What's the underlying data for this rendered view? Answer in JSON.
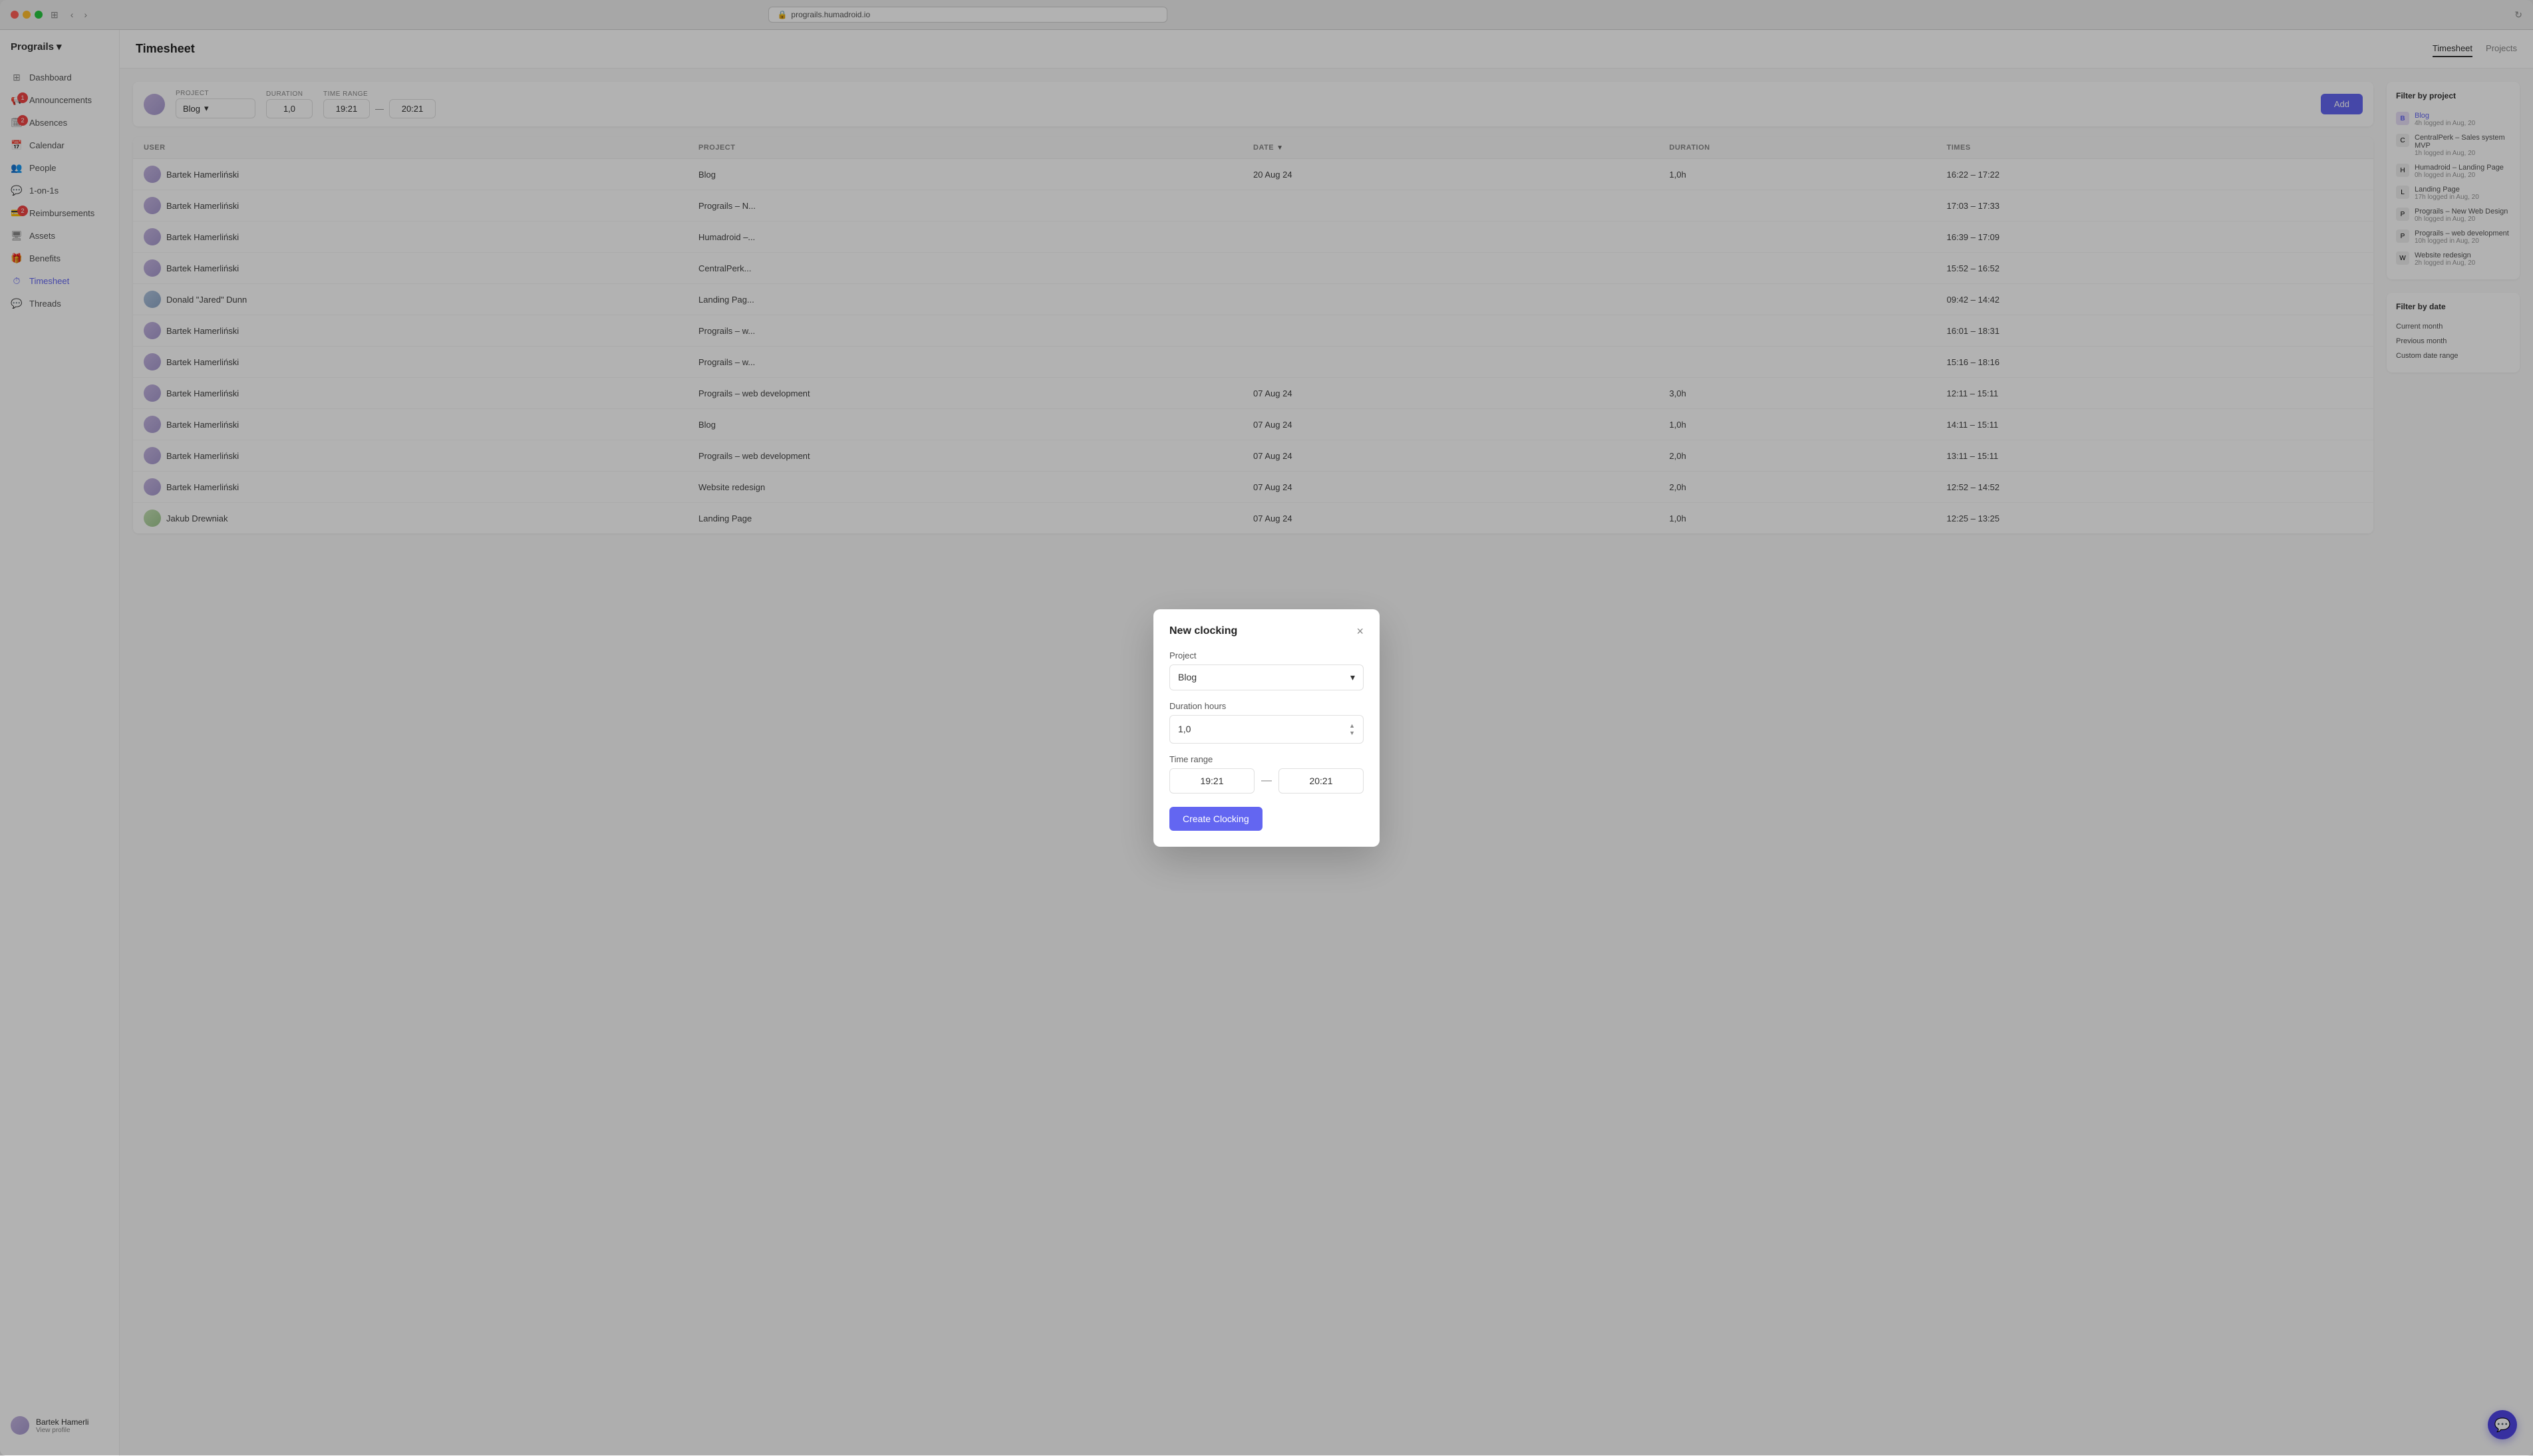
{
  "browser": {
    "url": "prograils.humadroid.io",
    "reload_icon": "↻"
  },
  "app": {
    "brand": "Prograils",
    "page_title": "Timesheet"
  },
  "header_tabs": [
    {
      "label": "Timesheet",
      "active": true
    },
    {
      "label": "Projects",
      "active": false
    }
  ],
  "sidebar": {
    "items": [
      {
        "label": "Dashboard",
        "icon": "⊞",
        "badge": null
      },
      {
        "label": "Announcements",
        "icon": "📢",
        "badge": "1"
      },
      {
        "label": "Absences",
        "icon": "🗓",
        "badge": "2"
      },
      {
        "label": "Calendar",
        "icon": "📅",
        "badge": null
      },
      {
        "label": "People",
        "icon": "👥",
        "badge": null
      },
      {
        "label": "1-on-1s",
        "icon": "💬",
        "badge": null
      },
      {
        "label": "Reimbursements",
        "icon": "💳",
        "badge": "2"
      },
      {
        "label": "Assets",
        "icon": "🖥",
        "badge": null
      },
      {
        "label": "Benefits",
        "icon": "🎁",
        "badge": null
      },
      {
        "label": "Timesheet",
        "icon": "⏱",
        "badge": null,
        "active": true
      },
      {
        "label": "Threads",
        "icon": "💬",
        "badge": null
      }
    ],
    "user": {
      "name": "Bartek Hamerli",
      "sub": "View profile"
    }
  },
  "add_row": {
    "project_label": "PROJECT",
    "project_value": "Blog",
    "duration_label": "DURATION",
    "duration_value": "1,0",
    "time_range_label": "TIME RANGE",
    "time_start": "19:21",
    "time_end": "20:21",
    "add_button": "Add"
  },
  "table": {
    "columns": [
      "USER",
      "PROJECT",
      "DATE",
      "DURATION",
      "TIMES"
    ],
    "rows": [
      {
        "user": "Bartek Hamerliński",
        "project": "Blog",
        "date": "20 Aug 24",
        "duration": "1,0h",
        "times": "16:22 – 17:22"
      },
      {
        "user": "Bartek Hamerliński",
        "project": "Prograils – N...",
        "date": "",
        "duration": "",
        "times": "17:03 – 17:33"
      },
      {
        "user": "Bartek Hamerliński",
        "project": "Humadroid –...",
        "date": "",
        "duration": "",
        "times": "16:39 – 17:09"
      },
      {
        "user": "Bartek Hamerliński",
        "project": "CentralPerk...",
        "date": "",
        "duration": "",
        "times": "15:52 – 16:52"
      },
      {
        "user": "Donald \"Jared\" Dunn",
        "project": "Landing Pag...",
        "date": "",
        "duration": "",
        "times": "09:42 – 14:42"
      },
      {
        "user": "Bartek Hamerliński",
        "project": "Prograils – w...",
        "date": "",
        "duration": "",
        "times": "16:01 – 18:31"
      },
      {
        "user": "Bartek Hamerliński",
        "project": "Prograils – w...",
        "date": "",
        "duration": "",
        "times": "15:16 – 18:16"
      },
      {
        "user": "Bartek Hamerliński",
        "project": "Prograils – web development",
        "date": "07 Aug 24",
        "duration": "3,0h",
        "times": "12:11 – 15:11"
      },
      {
        "user": "Bartek Hamerliński",
        "project": "Blog",
        "date": "07 Aug 24",
        "duration": "1,0h",
        "times": "14:11 – 15:11"
      },
      {
        "user": "Bartek Hamerliński",
        "project": "Prograils – web development",
        "date": "07 Aug 24",
        "duration": "2,0h",
        "times": "13:11 – 15:11"
      },
      {
        "user": "Bartek Hamerliński",
        "project": "Website redesign",
        "date": "07 Aug 24",
        "duration": "2,0h",
        "times": "12:52 – 14:52"
      },
      {
        "user": "Jakub Drewniak",
        "project": "Landing Page",
        "date": "07 Aug 24",
        "duration": "1,0h",
        "times": "12:25 – 13:25"
      }
    ]
  },
  "filter_by_project": {
    "title": "Filter by project",
    "items": [
      {
        "label": "Blog",
        "sub": "4h logged in Aug, 20",
        "active": true
      },
      {
        "label": "CentralPerk – Sales system MVP",
        "sub": "1h logged in Aug, 20",
        "active": false
      },
      {
        "label": "Humadroid – Landing Page",
        "sub": "0h logged in Aug, 20",
        "active": false
      },
      {
        "label": "Landing Page",
        "sub": "17h logged in Aug, 20",
        "active": false
      },
      {
        "label": "Prograils – New Web Design",
        "sub": "0h logged in Aug, 20",
        "active": false
      },
      {
        "label": "Prograils – web development",
        "sub": "10h logged in Aug, 20",
        "active": false
      },
      {
        "label": "Website redesign",
        "sub": "2h logged in Aug, 20",
        "active": false
      }
    ]
  },
  "filter_by_date": {
    "title": "Filter by date",
    "items": [
      {
        "label": "Current month"
      },
      {
        "label": "Previous month"
      },
      {
        "label": "Custom date range"
      }
    ]
  },
  "modal": {
    "title": "New clocking",
    "project_label": "Project",
    "project_value": "Blog",
    "duration_label": "Duration hours",
    "duration_value": "1,0",
    "time_range_label": "Time range",
    "time_start": "19:21",
    "time_end": "20:21",
    "submit_button": "Create Clocking",
    "close_icon": "×"
  }
}
